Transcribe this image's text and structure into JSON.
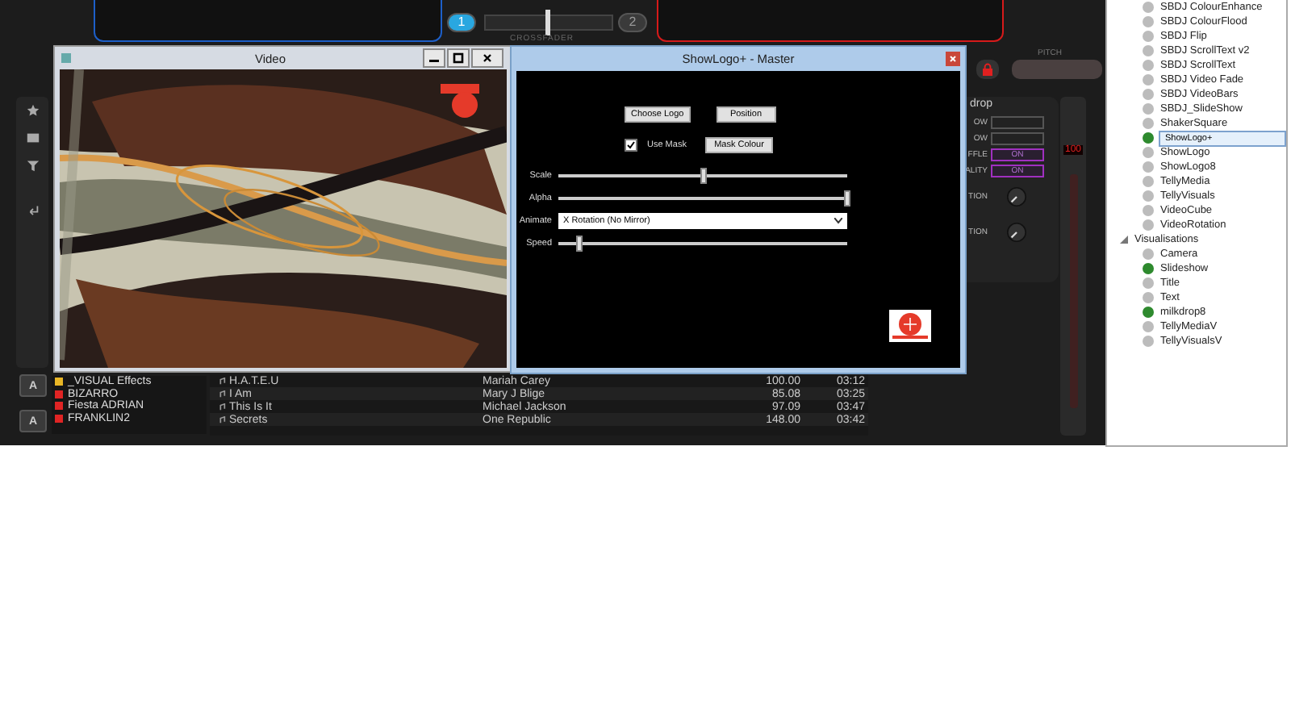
{
  "decks": {
    "deck_1_button": "1",
    "deck_2_button": "2",
    "crossfader_label": "CROSSFADER",
    "pitch_label": "PITCH"
  },
  "video_window": {
    "title": "Video"
  },
  "showlogo_window": {
    "title": "ShowLogo+ - Master",
    "choose_button": "Choose Logo",
    "position_button": "Position",
    "use_mask": {
      "label": "Use Mask",
      "checked": true
    },
    "mask_button": "Mask Colour",
    "rows": [
      {
        "kind": "slider",
        "label": "Scale",
        "level": 0.5
      },
      {
        "kind": "slider",
        "label": "Alpha",
        "level": 1.0
      },
      {
        "kind": "select",
        "label": "Animate",
        "value": "X Rotation (No Mirror)"
      },
      {
        "kind": "slider",
        "label": "Speed",
        "level": 0.07
      }
    ]
  },
  "effect_panel": {
    "title": "drop",
    "rows": [
      {
        "kind": "field",
        "label": "OW"
      },
      {
        "kind": "field",
        "label": "OW"
      },
      {
        "kind": "toggle",
        "label": "FFLE",
        "value": "ON"
      },
      {
        "kind": "toggle",
        "label": "ALITY",
        "value": "ON"
      },
      {
        "kind": "knob",
        "label": "TION"
      },
      {
        "kind": "knob",
        "label": "TION"
      }
    ],
    "volume": "100"
  },
  "side_buttons": [
    "A",
    "A"
  ],
  "folders": [
    {
      "kind": "effects",
      "name": "_VISUAL Effects"
    },
    {
      "kind": "playlist",
      "name": "BIZARRO"
    },
    {
      "kind": "playlist",
      "name": "Fiesta ADRIAN"
    },
    {
      "kind": "playlist",
      "name": "FRANKLIN2"
    }
  ],
  "tracks": [
    {
      "title": "H.A.T.E.U",
      "artist": "Mariah Carey",
      "bpm": "100.00",
      "length": "03:12"
    },
    {
      "title": "I Am",
      "artist": "Mary J Blige",
      "bpm": "85.08",
      "length": "03:25"
    },
    {
      "title": "This Is It",
      "artist": "Michael Jackson",
      "bpm": "97.09",
      "length": "03:47"
    },
    {
      "title": "Secrets",
      "artist": "One Republic",
      "bpm": "148.00",
      "length": "03:42"
    }
  ],
  "tree": {
    "effects": [
      {
        "label": "SBDJ ColourEnhance",
        "on": false,
        "selected": false
      },
      {
        "label": "SBDJ ColourFlood",
        "on": false,
        "selected": false
      },
      {
        "label": "SBDJ Flip",
        "on": false,
        "selected": false
      },
      {
        "label": "SBDJ ScrollText v2",
        "on": false,
        "selected": false
      },
      {
        "label": "SBDJ ScrollText",
        "on": false,
        "selected": false
      },
      {
        "label": "SBDJ Video Fade",
        "on": false,
        "selected": false
      },
      {
        "label": "SBDJ VideoBars",
        "on": false,
        "selected": false
      },
      {
        "label": "SBDJ_SlideShow",
        "on": false,
        "selected": false
      },
      {
        "label": "ShakerSquare",
        "on": false,
        "selected": false
      },
      {
        "label": "ShowLogo+",
        "on": true,
        "selected": true
      },
      {
        "label": "ShowLogo",
        "on": false,
        "selected": false
      },
      {
        "label": "ShowLogo8",
        "on": false,
        "selected": false
      },
      {
        "label": "TellyMedia",
        "on": false,
        "selected": false
      },
      {
        "label": "TellyVisuals",
        "on": false,
        "selected": false
      },
      {
        "label": "VideoCube",
        "on": false,
        "selected": false
      },
      {
        "label": "VideoRotation",
        "on": false,
        "selected": false
      }
    ],
    "group": {
      "label": "Visualisations",
      "expanded": true,
      "children": [
        {
          "label": "Camera",
          "on": false,
          "selected": false
        },
        {
          "label": "Slideshow",
          "on": true,
          "selected": false
        },
        {
          "label": "Title",
          "on": false,
          "selected": false
        },
        {
          "label": "Text",
          "on": false,
          "selected": false
        },
        {
          "label": "milkdrop8",
          "on": true,
          "selected": false
        },
        {
          "label": "TellyMediaV",
          "on": false,
          "selected": false
        },
        {
          "label": "TellyVisualsV",
          "on": false,
          "selected": false
        }
      ]
    }
  }
}
